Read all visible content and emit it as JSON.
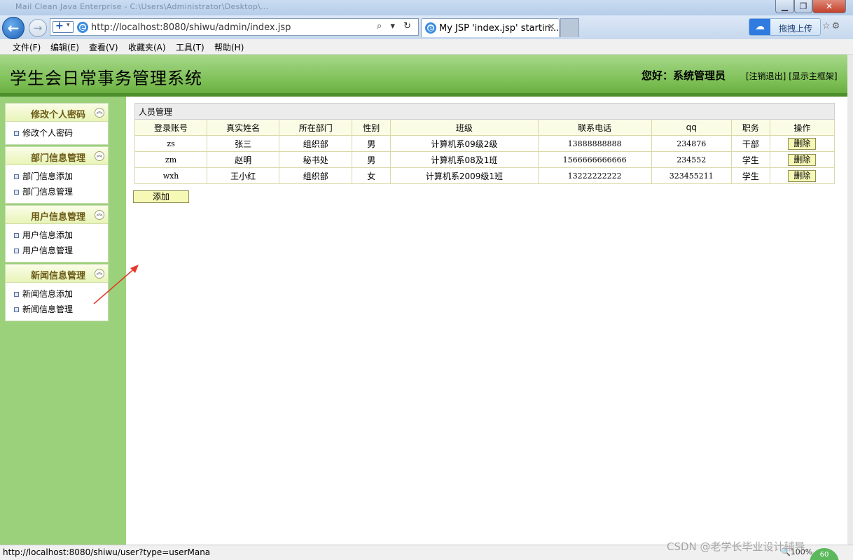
{
  "browser": {
    "ghost_title": "Mail Clean Java Enterprise - C:\\Users\\Administrator\\Desktop\\...",
    "address_url": "http://localhost:8080/shiwu/admin/index.jsp",
    "address_controls": "⌕ ▾ ↻",
    "tab_title": "My JSP 'index.jsp' startin...",
    "tab_close": "✕",
    "baidu_label": "拖拽上传",
    "menus": [
      "文件(F)",
      "编辑(E)",
      "查看(V)",
      "收藏夹(A)",
      "工具(T)",
      "帮助(H)"
    ],
    "status_url": "http://localhost:8080/shiwu/user?type=userMana",
    "zoom": "100%",
    "badge": "60"
  },
  "header": {
    "title": "学生会日常事务管理系统",
    "greeting": "您好：系统管理员",
    "logout": "[注销退出]",
    "show_frame": "[显示主框架]"
  },
  "sidebar": {
    "panels": [
      {
        "title": "修改个人密码",
        "links": [
          "修改个人密码"
        ]
      },
      {
        "title": "部门信息管理",
        "links": [
          "部门信息添加",
          "部门信息管理"
        ]
      },
      {
        "title": "用户信息管理",
        "links": [
          "用户信息添加",
          "用户信息管理"
        ]
      },
      {
        "title": "新闻信息管理",
        "links": [
          "新闻信息添加",
          "新闻信息管理"
        ]
      }
    ]
  },
  "main": {
    "caption": "人员管理",
    "columns": [
      "登录账号",
      "真实姓名",
      "所在部门",
      "性别",
      "班级",
      "联系电话",
      "qq",
      "职务",
      "操作"
    ],
    "rows": [
      [
        "zs",
        "张三",
        "组织部",
        "男",
        "计算机系09级2级",
        "13888888888",
        "234876",
        "干部"
      ],
      [
        "zm",
        "赵明",
        "秘书处",
        "男",
        "计算机系08及1班",
        "1566666666666",
        "234552",
        "学生"
      ],
      [
        "wxh",
        "王小红",
        "组织部",
        "女",
        "计算机系2009级1班",
        "13222222222",
        "323455211",
        "学生"
      ]
    ],
    "delete_label": "删除",
    "add_label": "添加"
  },
  "watermark": "CSDN @老学长毕业设计辅导",
  "colors": {
    "sidebar_bg": "#9bd17a",
    "header_bg": "#7dbf55",
    "button_bg": "#f6f8b5"
  }
}
